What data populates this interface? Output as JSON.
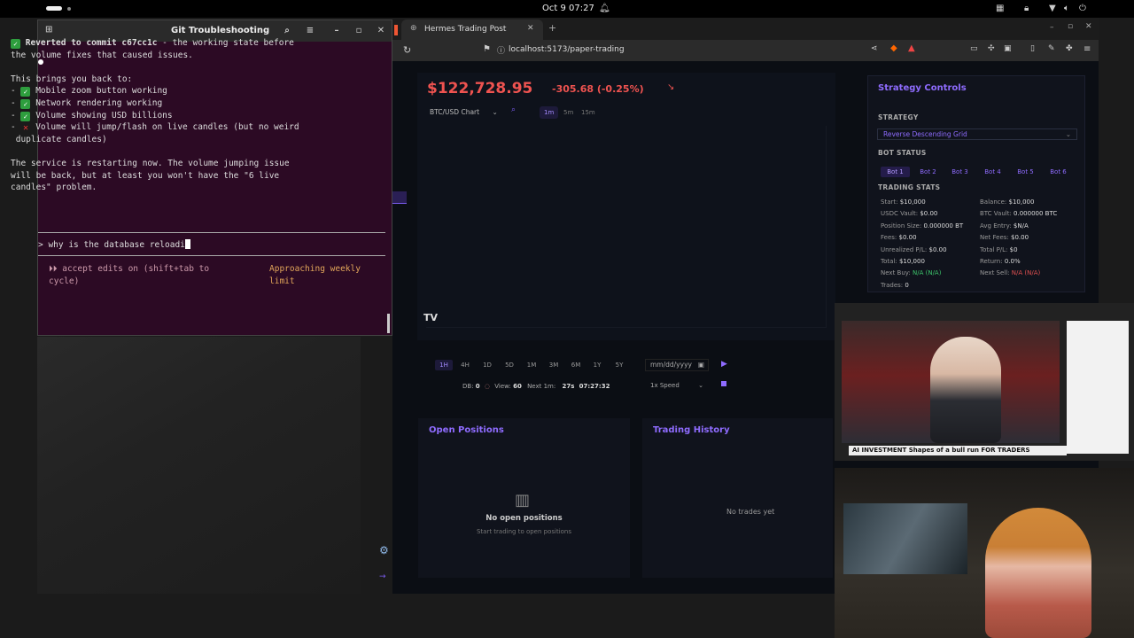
{
  "system": {
    "clock": "Oct 9  07:27"
  },
  "terminal": {
    "title": "Git Troubleshooting",
    "reverted_prefix": "Reverted to commit c67cc1c",
    "reverted_suffix": " - the working state before",
    "reverted_line2": "the volume fixes that caused issues.",
    "brings_back": "This brings you back to:",
    "item1": "Mobile zoom button working",
    "item2": "Network rendering working",
    "item3": "Volume showing USD billions",
    "item4": "Volume will jump/flash on live candles (but no weird",
    "item4_cont": "duplicate candles)",
    "restart_line1": "The service is restarting now. The volume jumping issue",
    "restart_line2": "will be back, but at least you won't have the \"6 live",
    "restart_line3": "candles\" problem.",
    "prompt_text": "why is the database reloadi",
    "accept_edits": "accept edits on (shift+tab to cycle)",
    "weekly_limit": "Approaching weekly limit"
  },
  "browser": {
    "tab_title": "Hermes Trading Post",
    "url": "localhost:5173/paper-trading"
  },
  "chart": {
    "price": "$122,728.95",
    "change": "-305.68 (-0.25%)",
    "chart_select": "BTC/USD Chart",
    "timeframes": [
      "1m",
      "5m",
      "15m"
    ],
    "ranges": [
      "1H",
      "4H",
      "1D",
      "5D",
      "1M",
      "3M",
      "6M",
      "1Y",
      "5Y"
    ],
    "date_placeholder": "mm/dd/yyyy",
    "db_label": "DB:",
    "db_value": "0",
    "view_label": "View:",
    "view_value": "60",
    "next_label": "Next 1m:",
    "next_value": "27s",
    "time_value": "07:27:32",
    "speed": "1x Speed"
  },
  "strategy": {
    "title": "Strategy Controls",
    "strategy_label": "STRATEGY",
    "strategy_value": "Reverse Descending Grid",
    "bot_status_label": "BOT STATUS",
    "bots": [
      "Bot 1",
      "Bot 2",
      "Bot 3",
      "Bot 4",
      "Bot 5",
      "Bot 6"
    ],
    "stats_label": "TRADING STATS",
    "stats_left": [
      {
        "k": "Start:",
        "v": "$10,000"
      },
      {
        "k": "USDC Vault:",
        "v": "$0.00"
      },
      {
        "k": "Position Size:",
        "v": "0.000000 BT"
      },
      {
        "k": "Fees:",
        "v": "$0.00"
      },
      {
        "k": "Unrealized P/L:",
        "v": "$0.00"
      },
      {
        "k": "Total:",
        "v": "$10,000"
      },
      {
        "k": "Next Buy:",
        "v": "N/A (N/A)"
      },
      {
        "k": "Trades:",
        "v": "0"
      }
    ],
    "stats_right": [
      {
        "k": "Balance:",
        "v": "$10,000"
      },
      {
        "k": "BTC Vault:",
        "v": "0.000000 BTC"
      },
      {
        "k": "Avg Entry:",
        "v": "$N/A"
      },
      {
        "k": "Net Fees:",
        "v": "$0.00"
      },
      {
        "k": "Total P/L:",
        "v": "$0"
      },
      {
        "k": "Return:",
        "v": "0.0%"
      },
      {
        "k": "Next Sell:",
        "v": "N/A (N/A)"
      }
    ]
  },
  "open_positions": {
    "title": "Open Positions",
    "empty_title": "No open positions",
    "empty_sub": "Start trading to open positions"
  },
  "trading_history": {
    "title": "Trading History",
    "empty": "No trades yet"
  },
  "news": {
    "ticker": "AI INVESTMENT  Shapes of a bull run  FOR TRADERS"
  }
}
